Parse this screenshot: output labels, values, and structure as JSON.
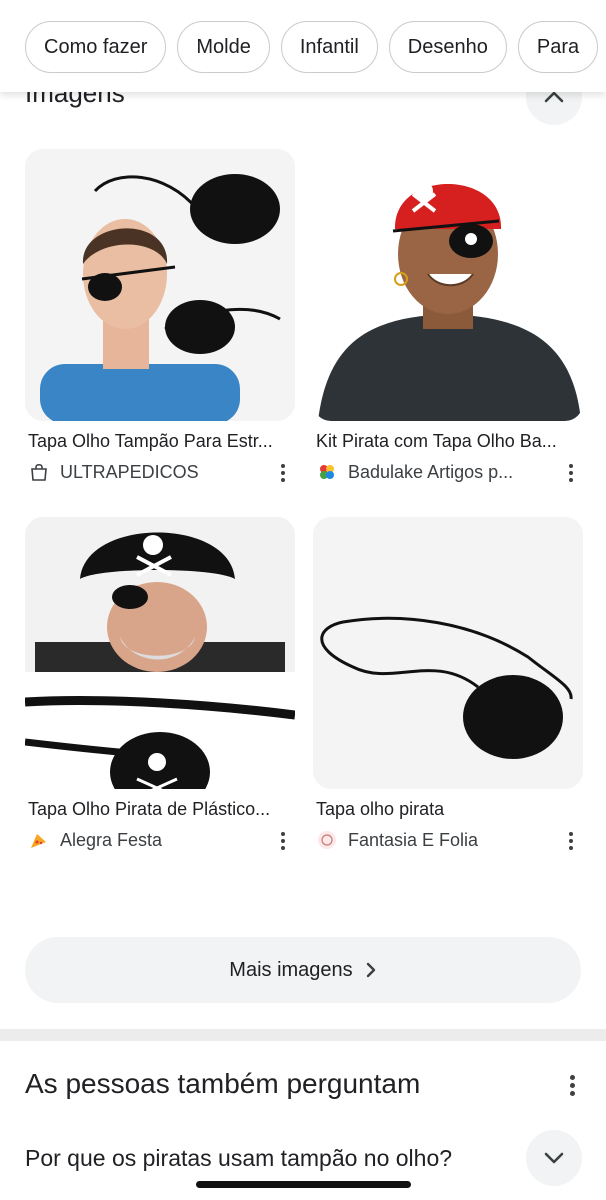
{
  "filter_chips": [
    "Como fazer",
    "Molde",
    "Infantil",
    "Desenho",
    "Para"
  ],
  "images_section": {
    "title": "Imagens",
    "collapse_icon": "chevron-up-icon",
    "results": [
      {
        "title": "Tapa Olho Tampão Para Estr...",
        "source": "ULTRAPEDICOS",
        "source_icon": "shopping-bag-icon"
      },
      {
        "title": "Kit Pirata com Tapa Olho Ba...",
        "source": "Badulake Artigos p...",
        "source_icon": "colorful-favicon"
      },
      {
        "title": "Tapa Olho Pirata de Plástico...",
        "source": "Alegra Festa",
        "source_icon": "party-favicon"
      },
      {
        "title": "Tapa olho pirata",
        "source": "Fantasia E Folia",
        "source_icon": "round-favicon"
      }
    ],
    "more_button": "Mais imagens"
  },
  "people_also_ask": {
    "title": "As pessoas também perguntam",
    "questions": [
      "Por que os piratas usam tampão no olho?"
    ]
  }
}
